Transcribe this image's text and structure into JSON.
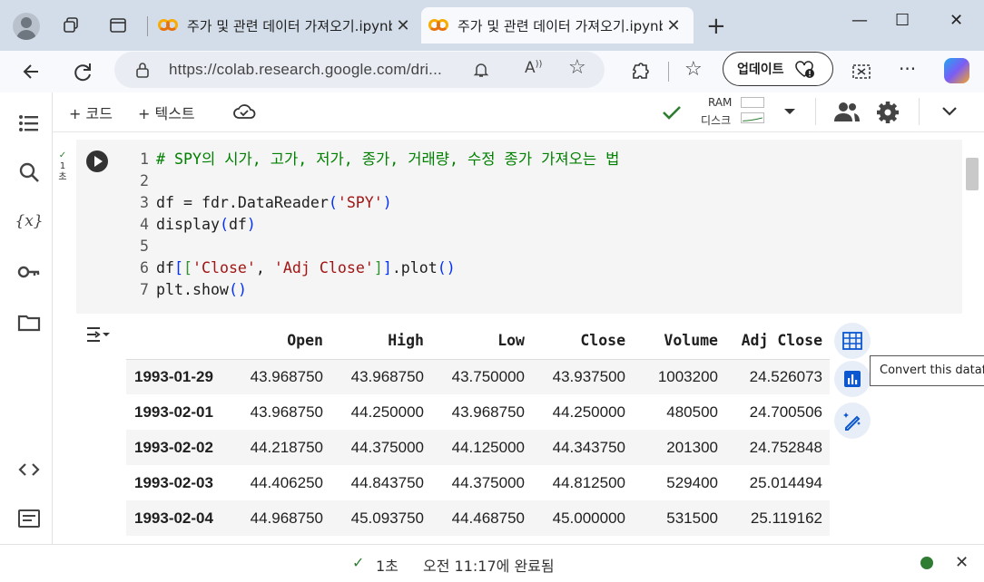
{
  "browser": {
    "tabs": [
      {
        "title": "주가 및 관련 데이터 가져오기.ipynb",
        "close": "✕"
      },
      {
        "title": "주가 및 관련 데이터 가져오기.ipynb",
        "close": "✕"
      }
    ],
    "new_tab": "+",
    "window_controls": {
      "minimize": "—",
      "maximize": "☐",
      "close": "✕"
    },
    "url": "https://colab.research.google.com/dri...",
    "update_button": "업데이트"
  },
  "colab": {
    "toolbar": {
      "add_code": "+ 코드",
      "add_text": "+ 텍스트",
      "ram_label": "RAM",
      "disk_label": "디스크"
    },
    "cell": {
      "status_check": "✓",
      "status_time": "1초",
      "lines": [
        {
          "n": "1",
          "text": "# SPY의 시가, 고가, 저가, 종가, 거래량, 수정 종가 가져오는 법"
        },
        {
          "n": "2",
          "text": ""
        },
        {
          "n": "3",
          "text": "df = fdr.DataReader('SPY')"
        },
        {
          "n": "4",
          "text": "display(df)"
        },
        {
          "n": "5",
          "text": ""
        },
        {
          "n": "6",
          "text": "df[['Close', 'Adj Close']].plot()"
        },
        {
          "n": "7",
          "text": "plt.show()"
        }
      ]
    },
    "dataframe": {
      "columns": [
        "Open",
        "High",
        "Low",
        "Close",
        "Volume",
        "Adj Close"
      ],
      "rows": [
        {
          "date": "1993-01-29",
          "values": [
            "43.968750",
            "43.968750",
            "43.750000",
            "43.937500",
            "1003200",
            "24.526073"
          ]
        },
        {
          "date": "1993-02-01",
          "values": [
            "43.968750",
            "44.250000",
            "43.968750",
            "44.250000",
            "480500",
            "24.700506"
          ]
        },
        {
          "date": "1993-02-02",
          "values": [
            "44.218750",
            "44.375000",
            "44.125000",
            "44.343750",
            "201300",
            "24.752848"
          ]
        },
        {
          "date": "1993-02-03",
          "values": [
            "44.406250",
            "44.843750",
            "44.375000",
            "44.812500",
            "529400",
            "25.014494"
          ]
        },
        {
          "date": "1993-02-04",
          "values": [
            "44.968750",
            "45.093750",
            "44.468750",
            "45.000000",
            "531500",
            "25.119162"
          ]
        }
      ]
    },
    "tooltip": "Convert this datafr",
    "status": {
      "check": "✓",
      "time": "1초",
      "completed": "오전 11:17에 완료됨",
      "close": "✕"
    }
  },
  "colors": {
    "accent": "#0b57d0",
    "success": "#2e7d32"
  }
}
